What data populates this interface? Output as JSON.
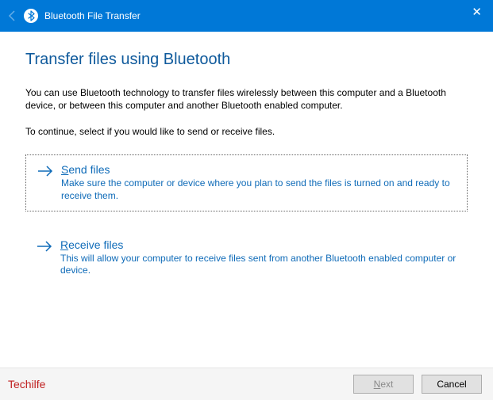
{
  "window": {
    "title": "Bluetooth File Transfer"
  },
  "close_label": "✕",
  "heading": "Transfer files using Bluetooth",
  "intro": "You can use Bluetooth technology to transfer files wirelessly between this computer and a Bluetooth device, or between this computer and another Bluetooth enabled computer.",
  "instruction": "To continue, select if you would like to send or receive files.",
  "options": {
    "send": {
      "mnemonic": "S",
      "rest": "end files",
      "desc": "Make sure the computer or device where you plan to send the files is turned on and ready to receive them."
    },
    "receive": {
      "mnemonic": "R",
      "rest": "eceive files",
      "desc": "This will allow your computer to receive files sent from another Bluetooth enabled computer or device."
    }
  },
  "footer": {
    "watermark": "Techilfe",
    "next": {
      "mnemonic": "N",
      "rest": "ext"
    },
    "cancel": "Cancel"
  }
}
